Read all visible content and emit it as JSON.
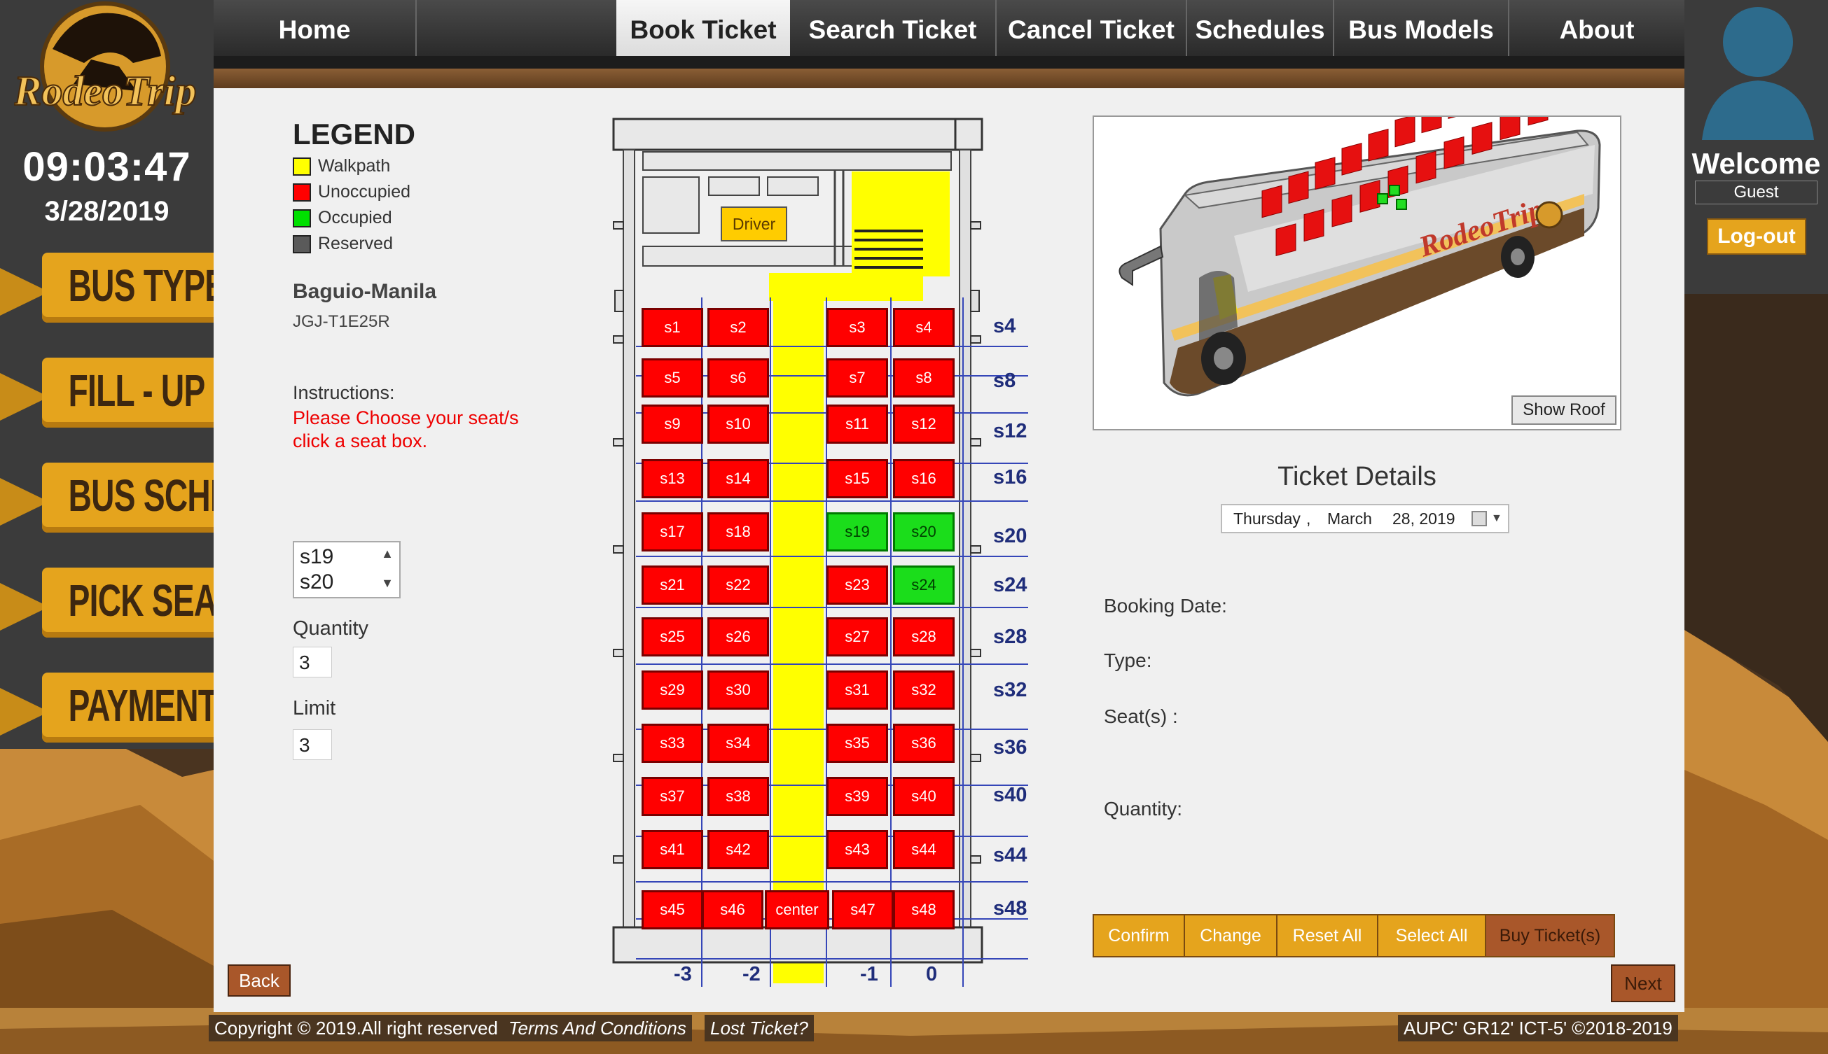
{
  "brand": {
    "logo_text": "RodeoTrip"
  },
  "clock": {
    "time": "09:03:47",
    "date": "3/28/2019"
  },
  "steps": [
    {
      "label": "BUS TYPE"
    },
    {
      "label": "FILL - UP"
    },
    {
      "label": "BUS SCHED."
    },
    {
      "label": "PICK SEATS"
    },
    {
      "label": "PAYMENT"
    }
  ],
  "nav": {
    "items": [
      {
        "label": "Home"
      },
      {
        "label": "Book Ticket",
        "active": true
      },
      {
        "label": "Search Ticket"
      },
      {
        "label": "Cancel Ticket"
      },
      {
        "label": "Schedules"
      },
      {
        "label": "Bus Models"
      },
      {
        "label": "About"
      }
    ]
  },
  "user": {
    "welcome": "Welcome",
    "name": "Guest",
    "logout": "Log-out"
  },
  "legend": {
    "title": "LEGEND",
    "items": [
      {
        "label": "Walkpath",
        "color": "#ffff00"
      },
      {
        "label": "Unoccupied",
        "color": "#ff0000"
      },
      {
        "label": "Occupied",
        "color": "#00e000"
      },
      {
        "label": "Reserved",
        "color": "#5a5a5a"
      }
    ]
  },
  "trip": {
    "route": "Baguio-Manila",
    "code": "JGJ-T1E25R"
  },
  "instructions": {
    "label": "Instructions:",
    "line1": "Please Choose your seat/s",
    "line2": "click a seat box."
  },
  "selected_seats": [
    "s19",
    "s20"
  ],
  "quantity": {
    "label": "Quantity",
    "value": "3"
  },
  "limit": {
    "label": "Limit",
    "value": "3"
  },
  "bus_map": {
    "driver_label": "Driver",
    "rows": [
      [
        "s1",
        "s2",
        "s3",
        "s4"
      ],
      [
        "s5",
        "s6",
        "s7",
        "s8"
      ],
      [
        "s9",
        "s10",
        "s11",
        "s12"
      ],
      [
        "s13",
        "s14",
        "s15",
        "s16"
      ],
      [
        "s17",
        "s18",
        "s19",
        "s20"
      ],
      [
        "s21",
        "s22",
        "s23",
        "s24"
      ],
      [
        "s25",
        "s26",
        "s27",
        "s28"
      ],
      [
        "s29",
        "s30",
        "s31",
        "s32"
      ],
      [
        "s33",
        "s34",
        "s35",
        "s36"
      ],
      [
        "s37",
        "s38",
        "s39",
        "s40"
      ],
      [
        "s41",
        "s42",
        "s43",
        "s44"
      ]
    ],
    "last_row": [
      "s45",
      "s46",
      "center",
      "s47",
      "s48"
    ],
    "occupied": [
      "s19",
      "s20",
      "s24"
    ],
    "row_labels": [
      "s4",
      "s8",
      "s12",
      "s16",
      "s20",
      "s24",
      "s28",
      "s32",
      "s36",
      "s40",
      "s44",
      "s48"
    ],
    "col_labels": [
      "-3",
      "-2",
      "-1",
      "0"
    ]
  },
  "bus_preview": {
    "logo_text": "RodeoTrip",
    "show_roof": "Show Roof"
  },
  "ticket_details": {
    "title": "Ticket Details",
    "date_day": "Thursday",
    "date_sep": ",",
    "date_month": "March",
    "date_rest": "28, 2019",
    "booking_date_label": "Booking Date:",
    "type_label": "Type:",
    "seats_label": "Seat(s) :",
    "quantity_label": "Quantity:"
  },
  "actions": [
    {
      "label": "Confirm"
    },
    {
      "label": "Change"
    },
    {
      "label": "Reset All"
    },
    {
      "label": "Select All"
    },
    {
      "label": "Buy Ticket(s)"
    }
  ],
  "back": "Back",
  "next": "Next",
  "footer": {
    "copyright": "Copyright © 2019.All right reserved",
    "terms": "Terms And Conditions",
    "lost": "Lost Ticket?",
    "credit": "AUPC' GR12' ICT-5' ©2018-2019"
  }
}
